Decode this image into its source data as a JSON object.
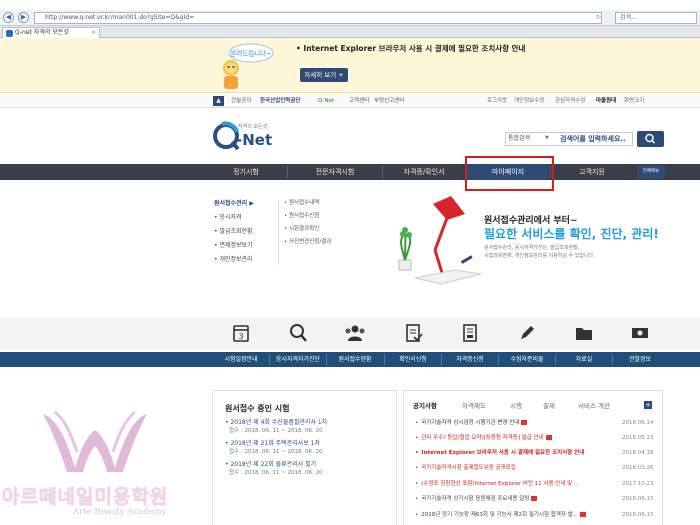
{
  "browser": {
    "url": "http://www.q-net.or.kr/man001.do?gSite=Q&gId=",
    "search_placeholder": "검색...",
    "tab_title": "Q-net 자격의 모든것",
    "nav_back": "◀",
    "nav_forward": "▶"
  },
  "notice": {
    "figure_text": "알려드립니다~",
    "message": "• Internet Explorer 브라우저 사용 시 결제에 필요한 조치사항 안내",
    "button": "자세히 보기 +"
  },
  "utility": {
    "up": "▲",
    "left": [
      "건설공지",
      "한국산업인력공단",
      "Q-Net",
      "고객센터",
      "부정신고센터"
    ],
    "right": [
      "로그아웃",
      "개인정보수정",
      "관심자격수정",
      "마을원대",
      "화면크기"
    ]
  },
  "header": {
    "logo_sub": "자격의 모든것",
    "logo_text": "-Net",
    "search_category": "통합검색",
    "search_placeholder": "검색어를 입력하세요.."
  },
  "gnb": {
    "items": [
      "정기시험",
      "전문자격시험",
      "자격증/확인서",
      "마이페이지",
      "고객지원"
    ],
    "all_menu": "전체메뉴"
  },
  "submenu": {
    "level1": [
      "원서접수관리 ▶",
      "• 응시자격",
      "• 발급조회현황",
      "• 면제정보보기",
      "• 개인정보관리"
    ],
    "level2": [
      "• 원서접수내역",
      "• 원서접수신청",
      "• 시험결과확인",
      "• 사진변경신청/결과"
    ]
  },
  "promo": {
    "h1": "원서접수관리에서 부터~",
    "h2": "필요한 서비스를 확인, 진단, 관리!",
    "lines": [
      "원서접수관리, 응시자격가진단, 발급조회현황,",
      "시험과목면제, 개인정보관리를 이용하실 수 있습니다."
    ]
  },
  "quick": {
    "calendar_num": "3",
    "labels": [
      "시험일정안내",
      "응시자격자가진단",
      "원서접수현황",
      "확인서신청",
      "자격증신청",
      "수험자준비물",
      "자료실",
      "관찰정보"
    ]
  },
  "applications": {
    "title": "원서접수 중인 시험",
    "items": [
      {
        "name": "• 2018년 제 4회 수산물품질관리사 1차",
        "dates": "접수 : 2018. 06. 11 ~ 2018. 06. 20"
      },
      {
        "name": "• 2018년 제 21회 주택관리사보 1차",
        "dates": "접수 : 2018. 06. 11 ~ 2018. 06. 20"
      },
      {
        "name": "• 2018년 제 22회 물류관리사 필기",
        "dates": "접수 : 2018. 06. 11 ~ 2018. 06. 20"
      }
    ]
  },
  "notices": {
    "tabs": [
      "공지사항",
      "자격제도",
      "시행",
      "출제",
      "서비스 개선"
    ],
    "plus": "+",
    "items": [
      {
        "text": "국가기술자격 상시검정 시행기관 변경 안내",
        "date": "2018.06.14"
      },
      {
        "text": "관리 우수! 등업(협업 요약)[장창청 자격증] 발급 안내",
        "date": "2018.05.23"
      },
      {
        "text": "Internet Explorer 브라우저 사용 시 결제에 필요한 조치사항 안내",
        "date": "2018.04.18"
      },
      {
        "text": "국가기술자격시험 출제합도위원 공개모집",
        "date": "2018.03.26"
      },
      {
        "text": "(수정포 장창현상 포함)Internet Explorer 버전 11 사용 안내 및 ...",
        "date": "2017.10.23"
      },
      {
        "text": "국가기술자격 상기시험 응원채점 주요내용 알림",
        "date": "2018.06.15"
      },
      {
        "text": "2018년 정기 기능장 제63회 및 기능사 제2회 필기시험 합격자 발...",
        "date": "2018.06.15"
      }
    ]
  },
  "watermark": {
    "korean": "아르떼네일미용학원",
    "english": "Arte Beauty Academy"
  },
  "colors": {
    "brand_navy": "#2e4a75",
    "gnb_dark": "#3a3e46",
    "quickbar": "#1e4e79",
    "highlight_red": "#d11f1f",
    "promo_blue": "#1e9ed9",
    "notice_bg": "#fdf6d8",
    "watermark_pink": "#f2d3ea"
  }
}
